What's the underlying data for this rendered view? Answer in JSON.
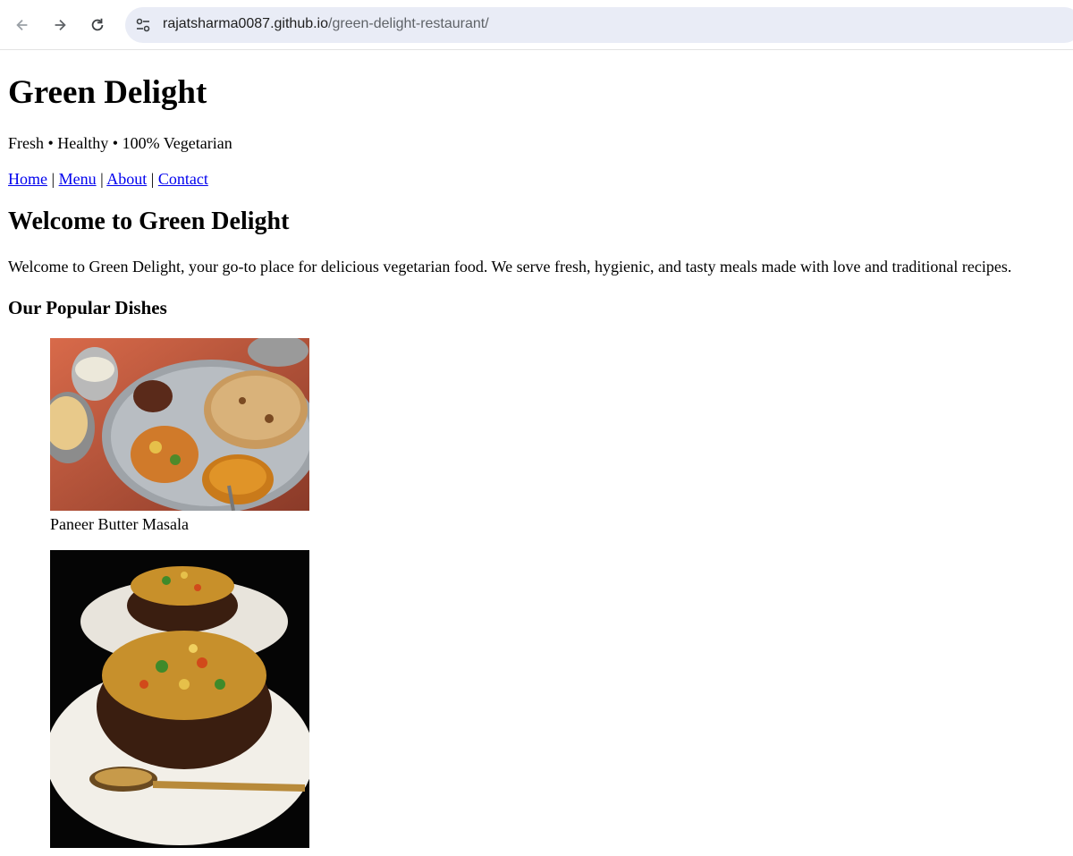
{
  "browser": {
    "url_host": "rajatsharma0087.github.io",
    "url_path": "/green-delight-restaurant/",
    "back_icon": "arrow-left-icon",
    "forward_icon": "arrow-right-icon",
    "reload_icon": "reload-icon",
    "site_info_icon": "tune-icon"
  },
  "header": {
    "title": "Green Delight",
    "tagline": "Fresh • Healthy • 100% Vegetarian"
  },
  "nav": {
    "items": [
      {
        "label": "Home"
      },
      {
        "label": "Menu"
      },
      {
        "label": "About"
      },
      {
        "label": "Contact"
      }
    ],
    "separator": "|"
  },
  "main": {
    "heading": "Welcome to Green Delight",
    "intro": "Welcome to Green Delight, your go-to place for delicious vegetarian food. We serve fresh, hygienic, and tasty meals made with love and traditional recipes.",
    "dishes_heading": "Our Popular Dishes",
    "dishes": [
      {
        "name": "Paneer Butter Masala"
      },
      {
        "name": ""
      }
    ]
  }
}
